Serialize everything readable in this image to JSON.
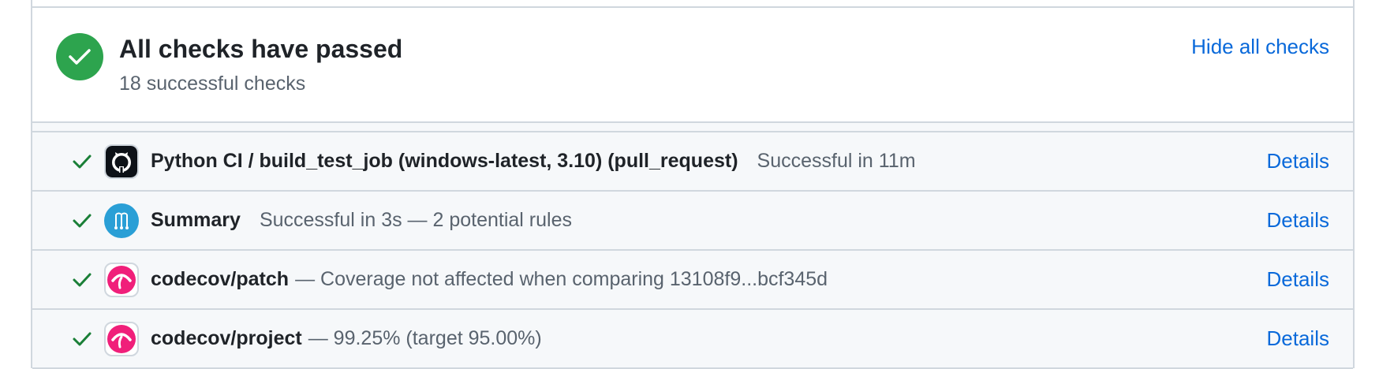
{
  "summary": {
    "title": "All checks have passed",
    "subtitle": "18 successful checks",
    "hide_link": "Hide all checks",
    "status_color": "#2da44e"
  },
  "checks": [
    {
      "name": "Python CI / build_test_job (windows-latest, 3.10) (pull_request)",
      "description": "Successful in 11m",
      "details_label": "Details",
      "icon": "github-icon"
    },
    {
      "name": "Summary",
      "description": "Successful in 3s — 2 potential rules",
      "details_label": "Details",
      "icon": "mergify-icon"
    },
    {
      "name": "codecov/patch",
      "description": "— Coverage not affected when comparing 13108f9...bcf345d",
      "details_label": "Details",
      "icon": "codecov-icon"
    },
    {
      "name": "codecov/project",
      "description": "— 99.25% (target 95.00%)",
      "details_label": "Details",
      "icon": "codecov-icon"
    }
  ],
  "colors": {
    "success": "#1a7f37",
    "link": "#0969da",
    "codecov": "#f01f7a",
    "mergify": "#2a9fd6"
  }
}
